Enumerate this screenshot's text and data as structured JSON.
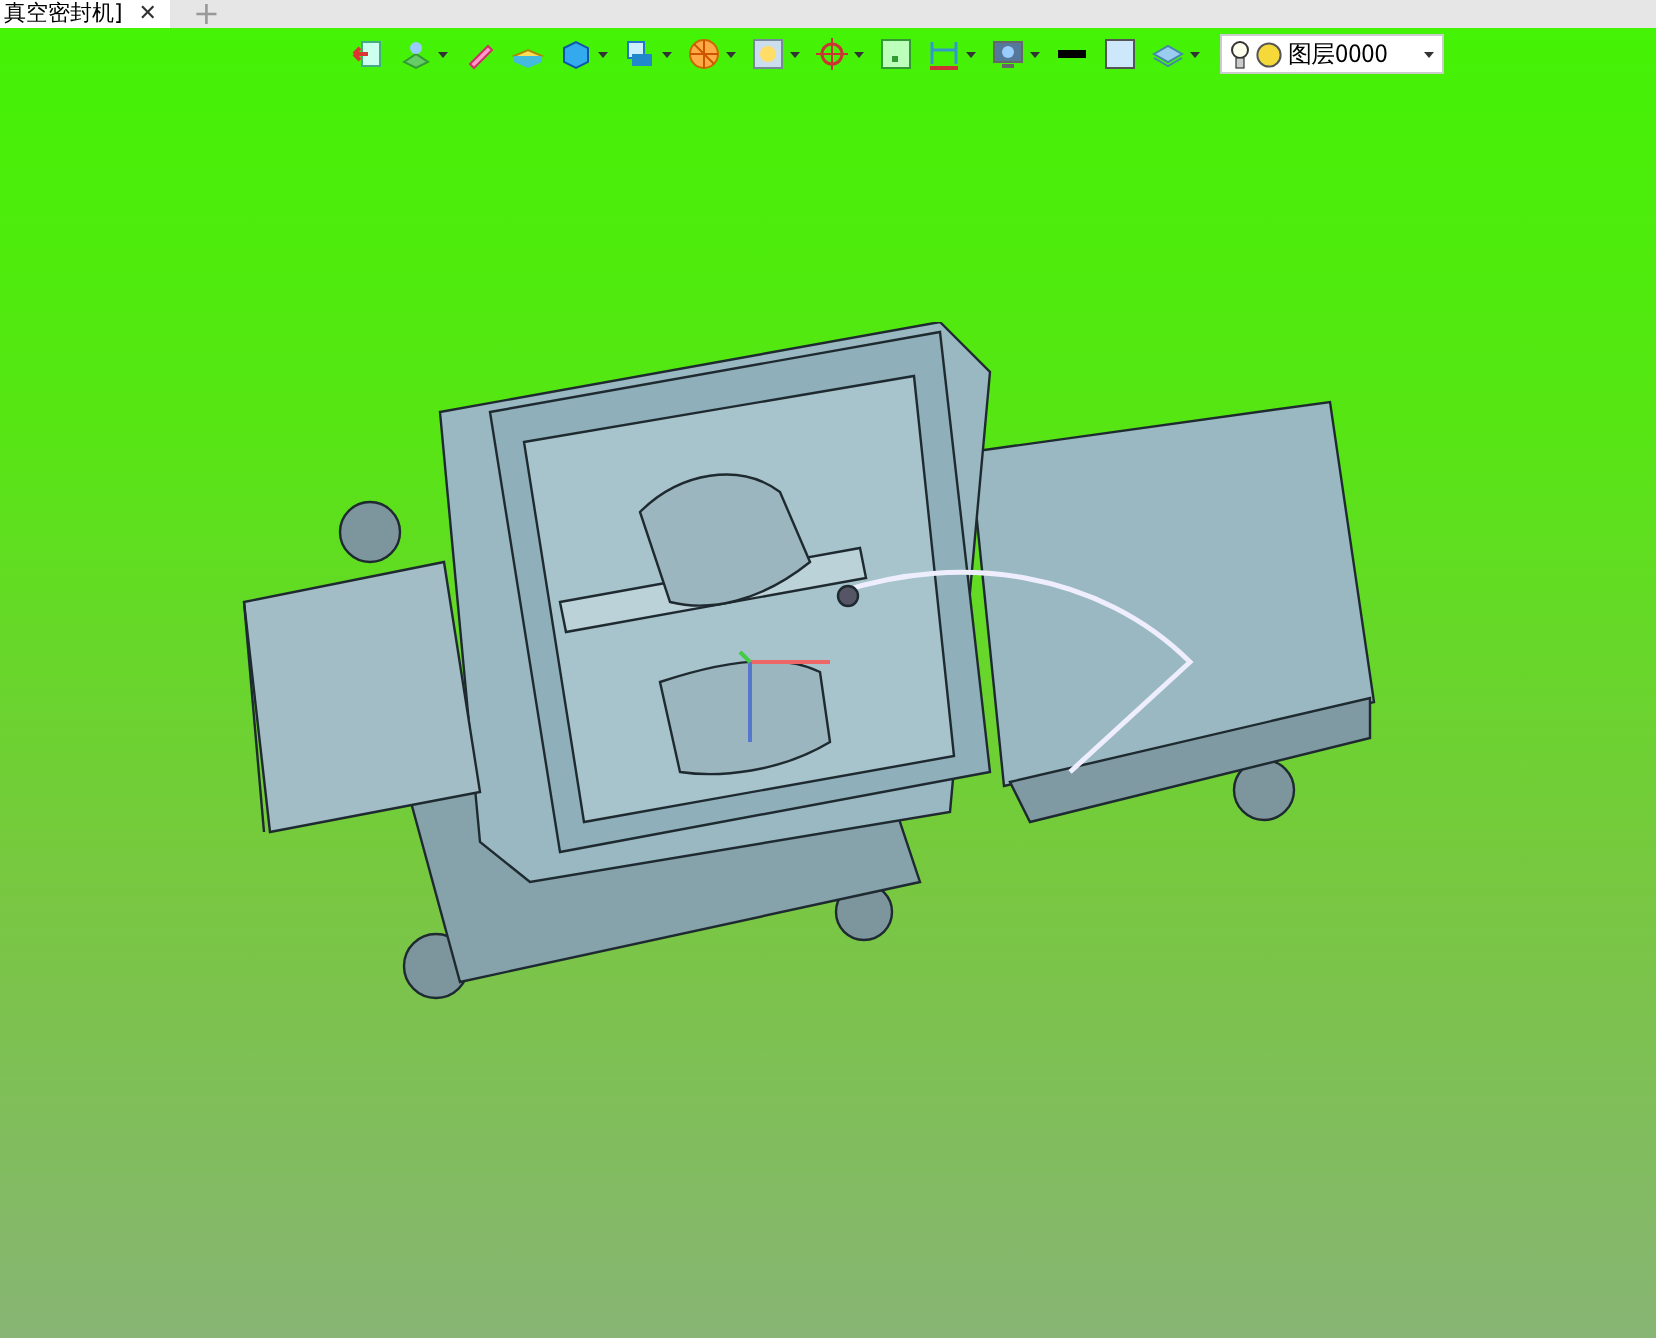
{
  "tabs": [
    {
      "label": "真空密封机]",
      "close": "✕",
      "selected": true
    },
    {
      "label": "+",
      "selected": false
    }
  ],
  "layer_dropdown": {
    "value": "图层0000"
  }
}
